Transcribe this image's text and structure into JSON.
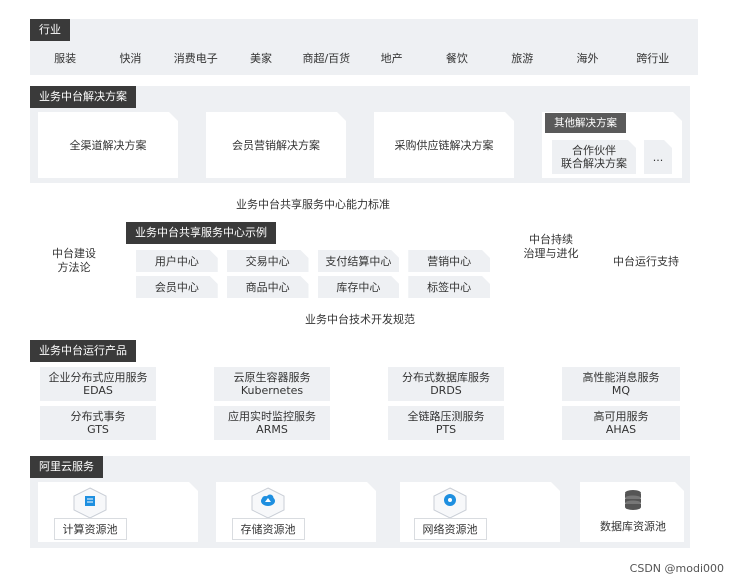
{
  "industry": {
    "tag": "行业",
    "items": [
      "服装",
      "快消",
      "消费电子",
      "美家",
      "商超/百货",
      "地产",
      "餐饮",
      "旅游",
      "海外",
      "跨行业"
    ]
  },
  "solutions": {
    "tag": "业务中台解决方案",
    "items": [
      "全渠道解决方案",
      "会员营销解决方案",
      "采购供应链解决方案"
    ],
    "other": {
      "tag": "其他解决方案",
      "partner_line1": "合作伙伴",
      "partner_line2": "联合解决方案",
      "more": "..."
    }
  },
  "middle": {
    "methodology_line1": "中台建设",
    "methodology_line2": "方法论",
    "standard": "业务中台共享服务中心能力标准",
    "examples_tag": "业务中台共享服务中心示例",
    "centers": [
      "用户中心",
      "交易中心",
      "支付结算中心",
      "营销中心",
      "会员中心",
      "商品中心",
      "库存中心",
      "标签中心"
    ],
    "tech_spec": "业务中台技术开发规范",
    "continuous_line1": "中台持续",
    "continuous_line2": "治理与进化",
    "ops_support": "中台运行支持"
  },
  "products": {
    "tag": "业务中台运行产品",
    "items": [
      {
        "name": "企业分布式应用服务",
        "code": "EDAS"
      },
      {
        "name": "云原生容器服务",
        "code": "Kubernetes"
      },
      {
        "name": "分布式数据库服务",
        "code": "DRDS"
      },
      {
        "name": "高性能消息服务",
        "code": "MQ"
      },
      {
        "name": "分布式事务",
        "code": "GTS"
      },
      {
        "name": "应用实时监控服务",
        "code": "ARMS"
      },
      {
        "name": "全链路压测服务",
        "code": "PTS"
      },
      {
        "name": "高可用服务",
        "code": "AHAS"
      }
    ]
  },
  "cloud": {
    "tag": "阿里云服务",
    "items": [
      {
        "label": "计算资源池",
        "icon": "compute-icon"
      },
      {
        "label": "存储资源池",
        "icon": "storage-icon"
      },
      {
        "label": "网络资源池",
        "icon": "network-icon"
      },
      {
        "label": "数据库资源池",
        "icon": "database-icon"
      }
    ]
  },
  "watermark": "CSDN @modi000",
  "colors": {
    "tag_bg": "#3a3a3a",
    "panel_bg": "#eef0f3",
    "icon_blue": "#1e8fe0"
  }
}
